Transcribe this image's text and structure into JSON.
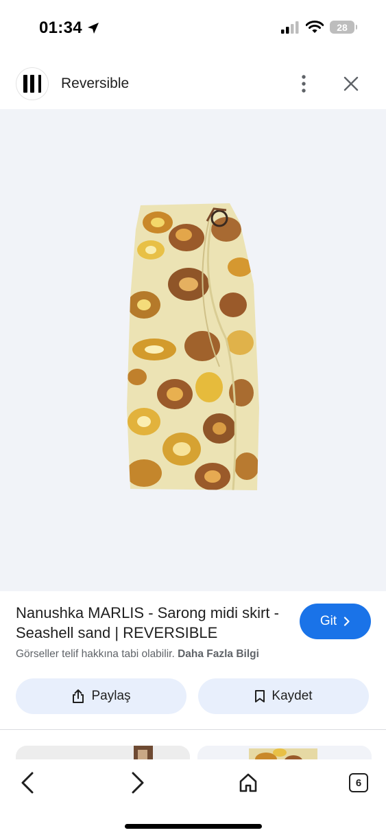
{
  "status_bar": {
    "time": "01:34",
    "battery": "28",
    "icons": [
      "location-arrow-icon",
      "signal-icon",
      "wifi-icon",
      "battery-icon"
    ]
  },
  "header": {
    "site_name": "Reversible",
    "icons": [
      "site-logo",
      "more-vert-icon",
      "close-icon"
    ]
  },
  "product": {
    "title": "Nanushka MARLIS - Sarong midi skirt - Seashell sand | REVERSIBLE",
    "go_label": "Git",
    "copyright_text": "Görseller telif hakkına tabi olabilir.",
    "learn_more": "Daha Fazla Bilgi"
  },
  "actions": {
    "share_label": "Paylaş",
    "save_label": "Kaydet"
  },
  "bottom_nav": {
    "tab_count": "6",
    "icons": [
      "back-icon",
      "forward-icon",
      "home-icon",
      "tabs-icon"
    ]
  },
  "colors": {
    "accent": "#1a73e8",
    "action_bg": "#e8effc",
    "image_bg": "#f1f3f8"
  }
}
